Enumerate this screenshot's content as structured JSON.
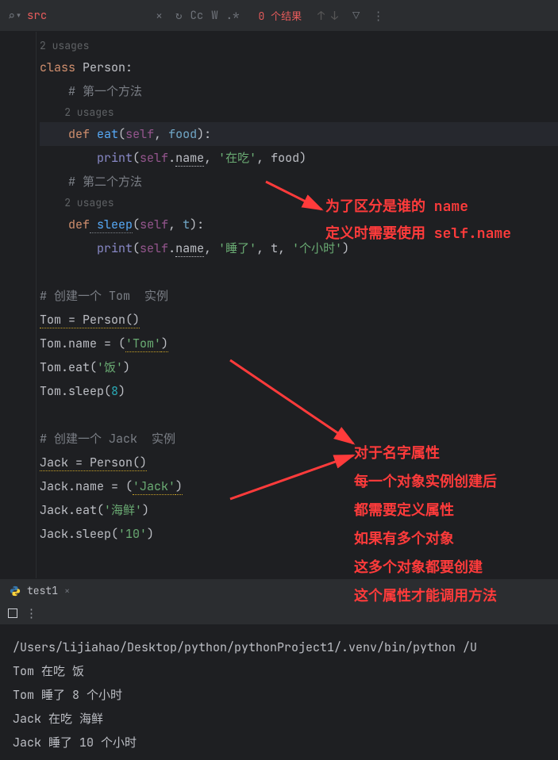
{
  "find": {
    "query": "src",
    "results": "0 个结果",
    "opts": {
      "cycle": "↻",
      "case": "Cc",
      "word": "W",
      "regex": ".*"
    }
  },
  "annotations": {
    "block1": {
      "l1": "为了区分是谁的 name",
      "l2": "定义时需要使用 self.name"
    },
    "block2": {
      "l1": "对于名字属性",
      "l2": "每一个对象实例创建后",
      "l3": "都需要定义属性",
      "l4": "如果有多个对象",
      "l5": "这多个对象都要创建",
      "l6": "这个属性才能调用方法"
    }
  },
  "code": {
    "usages2": "2 usages",
    "class_kw": "class",
    "class_name": " Person:",
    "cmt1": "# 第一个方法",
    "def_kw": "def",
    "eat_name": " eat",
    "self_txt": "self",
    "food_txt": " food",
    "print_name": "print",
    "name_attr": "name",
    "str_eating": "'在吃'",
    "cmt2": "# 第二个方法",
    "sleep_name": " sleep",
    "t_txt": " t",
    "str_sleep": "'睡了'",
    "str_hour": "'个小时'",
    "cmt_tom": "# 创建一个 Tom  实例",
    "tom_assign": "Tom = Person()",
    "tom_name_lhs": "Tom.name = (",
    "str_tom": "'Tom'",
    "tom_eat": "Tom.eat(",
    "str_rice": "'饭'",
    "tom_sleep": "Tom.sleep(",
    "num_8": "8",
    "cmt_jack": "# 创建一个 Jack  实例",
    "jack_assign": "Jack = Person()",
    "jack_name_lhs": "Jack.name = (",
    "str_jack": "'Jack'",
    "jack_eat": "Jack.eat(",
    "str_seafood": "'海鲜'",
    "jack_sleep": "Jack.sleep(",
    "str_10": "'10'"
  },
  "tab": {
    "label": "test1"
  },
  "terminal": {
    "cmd": "/Users/lijiahao/Desktop/python/pythonProject1/.venv/bin/python /U",
    "l1": "Tom 在吃 饭",
    "l2": "Tom 睡了 8 个小时",
    "l3": "Jack 在吃 海鲜",
    "l4": "Jack 睡了 10 个小时"
  }
}
